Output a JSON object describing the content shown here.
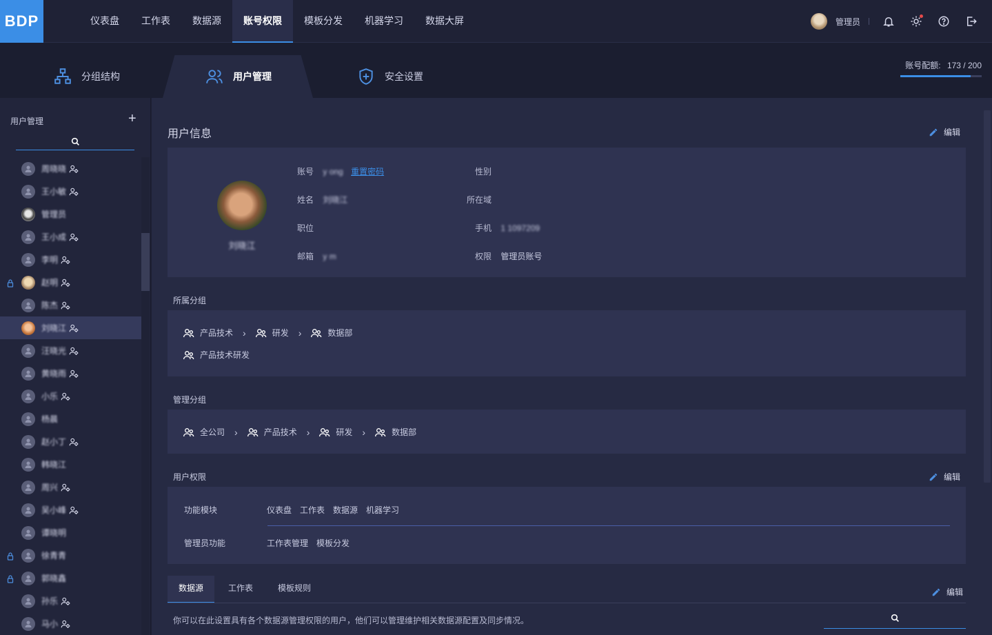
{
  "app": {
    "logo": "BDP"
  },
  "nav": {
    "items": [
      {
        "label": "仪表盘"
      },
      {
        "label": "工作表"
      },
      {
        "label": "数据源"
      },
      {
        "label": "账号权限",
        "active": true
      },
      {
        "label": "模板分发"
      },
      {
        "label": "机器学习"
      },
      {
        "label": "数据大屏"
      }
    ],
    "user": {
      "name": "管理员"
    },
    "icons": [
      "bell-icon",
      "settings-icon",
      "help-icon",
      "logout-icon"
    ]
  },
  "subtabs": {
    "items": [
      {
        "label": "分组结构",
        "icon": "org-chart-icon"
      },
      {
        "label": "用户管理",
        "icon": "users-icon",
        "active": true
      },
      {
        "label": "安全设置",
        "icon": "shield-icon"
      }
    ],
    "quota_label": "账号配额:",
    "quota_value": "173 / 200",
    "quota_fraction": 0.865
  },
  "sidebar": {
    "title": "用户管理",
    "add": "+",
    "users": [
      {
        "name": "周晓晓",
        "avatar": "default",
        "role": true,
        "lock": false
      },
      {
        "name": "王小敏",
        "avatar": "default",
        "role": true,
        "lock": false
      },
      {
        "name": "管理员",
        "avatar": "photo1",
        "role": false,
        "lock": false
      },
      {
        "name": "王小成",
        "avatar": "default",
        "role": true,
        "lock": false
      },
      {
        "name": "李明",
        "avatar": "default",
        "role": true,
        "lock": false
      },
      {
        "name": "赵明",
        "avatar": "photo2",
        "role": true,
        "lock": true
      },
      {
        "name": "陈杰",
        "avatar": "default",
        "role": true,
        "lock": false
      },
      {
        "name": "刘晓江",
        "avatar": "photo3",
        "role": true,
        "lock": false,
        "selected": true
      },
      {
        "name": "汪晓光",
        "avatar": "default",
        "role": true,
        "lock": false
      },
      {
        "name": "黄晓雨",
        "avatar": "default",
        "role": true,
        "lock": false
      },
      {
        "name": "小乐",
        "avatar": "default",
        "role": true,
        "lock": false
      },
      {
        "name": "杨晨",
        "avatar": "default",
        "role": false,
        "lock": false
      },
      {
        "name": "赵小丁",
        "avatar": "default",
        "role": true,
        "lock": false
      },
      {
        "name": "韩晓江",
        "avatar": "default",
        "role": false,
        "lock": false
      },
      {
        "name": "周兴",
        "avatar": "default",
        "role": true,
        "lock": false
      },
      {
        "name": "吴小峰",
        "avatar": "default",
        "role": true,
        "lock": false
      },
      {
        "name": "谭晓明",
        "avatar": "default",
        "role": false,
        "lock": false
      },
      {
        "name": "徐青青",
        "avatar": "default",
        "role": false,
        "lock": true
      },
      {
        "name": "郭晓鑫",
        "avatar": "default",
        "role": false,
        "lock": true
      },
      {
        "name": "孙乐",
        "avatar": "default",
        "role": true,
        "lock": false
      },
      {
        "name": "马小",
        "avatar": "default",
        "role": true,
        "lock": false
      }
    ]
  },
  "user_info": {
    "title": "用户信息",
    "edit": "编辑",
    "display_name": "刘晓江",
    "fields": {
      "account_label": "账号",
      "account_value": "y  ong",
      "reset_pwd": "重置密码",
      "gender_label": "性别",
      "gender_value": "",
      "name_label": "姓名",
      "name_value": "刘晓江",
      "domain_label": "所在域",
      "domain_value": "",
      "position_label": "职位",
      "position_value": "",
      "phone_label": "手机",
      "phone_value": "1 1097209",
      "email_label": "邮箱",
      "email_value": "y                m",
      "perm_label": "权限",
      "perm_value": "管理员账号"
    }
  },
  "member_groups": {
    "title": "所属分组",
    "path1": [
      "产品技术",
      "研发",
      "数据部"
    ],
    "path2": [
      "产品技术研发"
    ]
  },
  "manage_groups": {
    "title": "管理分组",
    "path": [
      "全公司",
      "产品技术",
      "研发",
      "数据部"
    ]
  },
  "permissions": {
    "title": "用户权限",
    "edit": "编辑",
    "module_label": "功能模块",
    "modules": [
      "仪表盘",
      "工作表",
      "数据源",
      "机器学习"
    ],
    "admin_label": "管理员功能",
    "admin_funcs": [
      "工作表管理",
      "模板分发"
    ]
  },
  "bottom_tabs": {
    "items": [
      {
        "label": "数据源",
        "active": true
      },
      {
        "label": "工作表"
      },
      {
        "label": "模板规则"
      }
    ],
    "edit": "编辑",
    "description": "你可以在此设置具有各个数据源管理权限的用户，他们可以管理维护相关数据源配置及同步情况。"
  },
  "colors": {
    "accent": "#3b8ee6",
    "bg": "#262a43",
    "panel": "#2f3351"
  }
}
